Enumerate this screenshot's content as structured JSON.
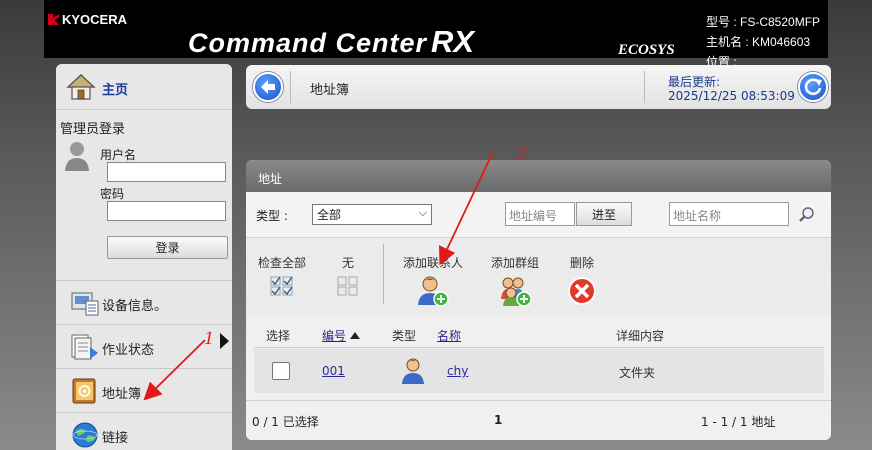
{
  "header": {
    "brand": "KYOCERA",
    "product": "Command Center",
    "product_suffix": "RX",
    "ecosys": "ECOSYS",
    "model": "型号 : FS-C8520MFP",
    "host": "主机名 : KM046603",
    "location": "位置 :"
  },
  "sidebar": {
    "home": "主页",
    "login_title": "管理员登录",
    "username_label": "用户名",
    "password_label": "密码",
    "login_button": "登录",
    "nav": [
      {
        "label": "设备信息。",
        "icon": "device-info-icon"
      },
      {
        "label": "作业状态",
        "icon": "job-status-icon"
      },
      {
        "label": "地址簿",
        "icon": "address-book-icon"
      },
      {
        "label": "链接",
        "icon": "links-globe-icon"
      }
    ]
  },
  "topbar": {
    "title": "地址簿",
    "last_updated_label": "最后更新:",
    "last_updated": "2025/12/25 08:53:09"
  },
  "panel": {
    "title": "地址",
    "type_label": "类型 :",
    "type_value": "全部",
    "address_number_placeholder": "地址编号",
    "go_button": "进至",
    "address_name_placeholder": "地址名称",
    "tools": {
      "check_all": "检查全部",
      "none": "无",
      "add_contact": "添加联系人",
      "add_group": "添加群组",
      "delete": "删除"
    },
    "columns": {
      "select": "选择",
      "number": "编号",
      "type": "类型",
      "name": "名称",
      "details": "详细内容"
    },
    "rows": [
      {
        "number": "001",
        "name": "chy",
        "details": "文件夹"
      }
    ],
    "footer": {
      "selected": "0 / 1 已选择",
      "page": "1",
      "range": "1 - 1 / 1 地址"
    }
  },
  "annotations": {
    "num1": "1",
    "num2": "2",
    "color": "#e01a1a"
  }
}
